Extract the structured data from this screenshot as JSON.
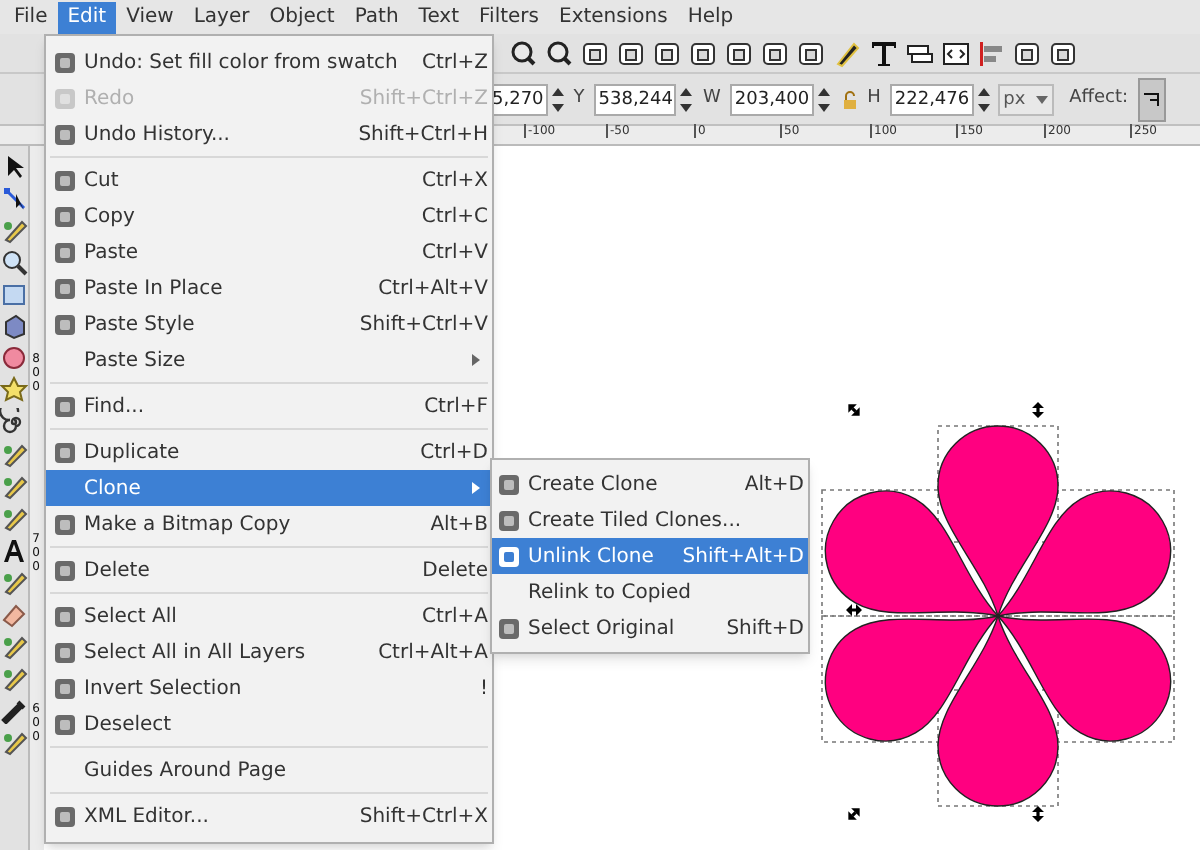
{
  "menubar": [
    {
      "label": "File",
      "selected": false
    },
    {
      "label": "Edit",
      "selected": true
    },
    {
      "label": "View",
      "selected": false
    },
    {
      "label": "Layer",
      "selected": false
    },
    {
      "label": "Object",
      "selected": false
    },
    {
      "label": "Path",
      "selected": false
    },
    {
      "label": "Text",
      "selected": false
    },
    {
      "label": "Filters",
      "selected": false
    },
    {
      "label": "Extensions",
      "selected": false
    },
    {
      "label": "Help",
      "selected": false
    }
  ],
  "toolbar": {
    "fields": [
      {
        "value": "5,270"
      },
      {
        "label": "Y",
        "value": "538,244"
      },
      {
        "label": "W",
        "value": "203,400"
      },
      {
        "label": "H",
        "value": "222,476"
      }
    ],
    "unit": "px",
    "affect_label": "Affect:"
  },
  "ruler": {
    "labels": [
      "-100",
      "-50",
      "0",
      "50",
      "100",
      "150",
      "200",
      "250"
    ],
    "vertical_labels": [
      "800",
      "700",
      "600"
    ]
  },
  "edit_menu": [
    {
      "kind": "item",
      "label": "Undo: Set fill color from swatch",
      "shortcut": "Ctrl+Z",
      "icon": true,
      "disabled": false,
      "selected": false,
      "submenu": false
    },
    {
      "kind": "item",
      "label": "Redo",
      "shortcut": "Shift+Ctrl+Z",
      "icon": true,
      "disabled": true,
      "selected": false,
      "submenu": false
    },
    {
      "kind": "item",
      "label": "Undo History...",
      "shortcut": "Shift+Ctrl+H",
      "icon": true,
      "disabled": false,
      "selected": false,
      "submenu": false
    },
    {
      "kind": "separator"
    },
    {
      "kind": "item",
      "label": "Cut",
      "shortcut": "Ctrl+X",
      "icon": true,
      "disabled": false,
      "selected": false,
      "submenu": false
    },
    {
      "kind": "item",
      "label": "Copy",
      "shortcut": "Ctrl+C",
      "icon": true,
      "disabled": false,
      "selected": false,
      "submenu": false
    },
    {
      "kind": "item",
      "label": "Paste",
      "shortcut": "Ctrl+V",
      "icon": true,
      "disabled": false,
      "selected": false,
      "submenu": false
    },
    {
      "kind": "item",
      "label": "Paste In Place",
      "shortcut": "Ctrl+Alt+V",
      "icon": true,
      "disabled": false,
      "selected": false,
      "submenu": false
    },
    {
      "kind": "item",
      "label": "Paste Style",
      "shortcut": "Shift+Ctrl+V",
      "icon": true,
      "disabled": false,
      "selected": false,
      "submenu": false
    },
    {
      "kind": "item",
      "label": "Paste Size",
      "icon": false,
      "disabled": false,
      "selected": false,
      "submenu": true
    },
    {
      "kind": "separator"
    },
    {
      "kind": "item",
      "label": "Find...",
      "shortcut": "Ctrl+F",
      "icon": true,
      "disabled": false,
      "selected": false,
      "submenu": false
    },
    {
      "kind": "separator"
    },
    {
      "kind": "item",
      "label": "Duplicate",
      "shortcut": "Ctrl+D",
      "icon": true,
      "disabled": false,
      "selected": false,
      "submenu": false
    },
    {
      "kind": "item",
      "label": "Clone",
      "icon": false,
      "disabled": false,
      "selected": true,
      "submenu": true
    },
    {
      "kind": "item",
      "label": "Make a Bitmap Copy",
      "shortcut": "Alt+B",
      "icon": true,
      "disabled": false,
      "selected": false,
      "submenu": false
    },
    {
      "kind": "separator"
    },
    {
      "kind": "item",
      "label": "Delete",
      "shortcut": "Delete",
      "icon": true,
      "disabled": false,
      "selected": false,
      "submenu": false
    },
    {
      "kind": "separator"
    },
    {
      "kind": "item",
      "label": "Select All",
      "shortcut": "Ctrl+A",
      "icon": true,
      "disabled": false,
      "selected": false,
      "submenu": false
    },
    {
      "kind": "item",
      "label": "Select All in All Layers",
      "shortcut": "Ctrl+Alt+A",
      "icon": true,
      "disabled": false,
      "selected": false,
      "submenu": false
    },
    {
      "kind": "item",
      "label": "Invert Selection",
      "shortcut": "!",
      "icon": true,
      "disabled": false,
      "selected": false,
      "submenu": false
    },
    {
      "kind": "item",
      "label": "Deselect",
      "icon": true,
      "disabled": false,
      "selected": false,
      "submenu": false
    },
    {
      "kind": "separator"
    },
    {
      "kind": "item",
      "label": "Guides Around Page",
      "icon": false,
      "disabled": false,
      "selected": false,
      "submenu": false
    },
    {
      "kind": "separator"
    },
    {
      "kind": "item",
      "label": "XML Editor...",
      "shortcut": "Shift+Ctrl+X",
      "icon": true,
      "disabled": false,
      "selected": false,
      "submenu": false
    }
  ],
  "clone_submenu": [
    {
      "label": "Create Clone",
      "shortcut": "Alt+D",
      "icon": true,
      "selected": false
    },
    {
      "label": "Create Tiled Clones...",
      "icon": true,
      "selected": false
    },
    {
      "label": "Unlink Clone",
      "shortcut": "Shift+Alt+D",
      "icon": true,
      "selected": true
    },
    {
      "label": "Relink to Copied",
      "icon": false,
      "selected": false
    },
    {
      "label": "Select Original",
      "shortcut": "Shift+D",
      "icon": true,
      "selected": false
    }
  ]
}
